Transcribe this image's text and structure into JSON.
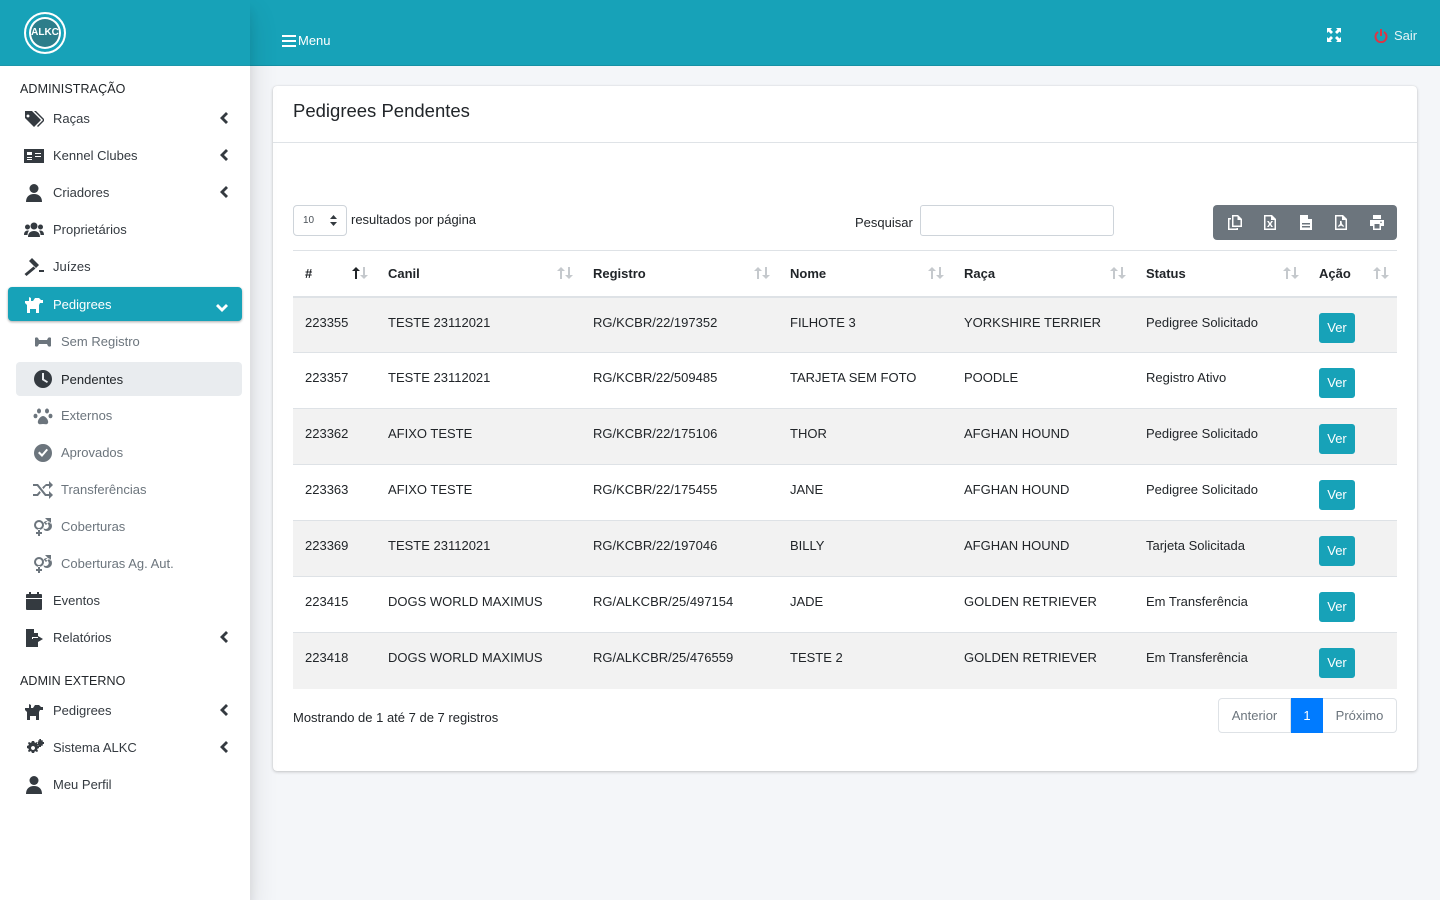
{
  "brand": {
    "logo_text": "ALKC"
  },
  "sidebar": {
    "header_admin": "ADMINISTRAÇÃO",
    "header_external": "ADMIN EXTERNO",
    "items": [
      {
        "label": "Raças",
        "icon": "tags-icon"
      },
      {
        "label": "Kennel Clubes",
        "icon": "id-card-icon"
      },
      {
        "label": "Criadores",
        "icon": "user-icon"
      },
      {
        "label": "Proprietários",
        "icon": "users-icon"
      },
      {
        "label": "Juízes",
        "icon": "gavel-icon"
      },
      {
        "label": "Pedigrees",
        "icon": "dog-icon"
      }
    ],
    "subitems": [
      {
        "label": "Sem Registro",
        "icon": "bone-icon"
      },
      {
        "label": "Pendentes",
        "icon": "clock-icon"
      },
      {
        "label": "Externos",
        "icon": "paw-icon"
      },
      {
        "label": "Aprovados",
        "icon": "check-circle-icon"
      },
      {
        "label": "Transferências",
        "icon": "random-icon"
      },
      {
        "label": "Coberturas",
        "icon": "venus-mars-icon"
      },
      {
        "label": "Coberturas Ag. Aut.",
        "icon": "venus-mars-icon"
      }
    ],
    "items2": [
      {
        "label": "Eventos",
        "icon": "calendar-icon"
      },
      {
        "label": "Relatórios",
        "icon": "file-export-icon"
      }
    ],
    "external_items": [
      {
        "label": "Pedigrees",
        "icon": "dog-icon"
      },
      {
        "label": "Sistema ALKC",
        "icon": "cogs-icon"
      },
      {
        "label": "Meu Perfil",
        "icon": "user-icon"
      }
    ]
  },
  "topbar": {
    "menu_label": "Menu",
    "logout_label": "Sair"
  },
  "card": {
    "title": "Pedigrees Pendentes"
  },
  "controls": {
    "page_length": "10",
    "page_length_label": "resultados por página",
    "search_label": "Pesquisar",
    "search_value": ""
  },
  "table": {
    "columns": [
      "#",
      "Canil",
      "Registro",
      "Nome",
      "Raça",
      "Status",
      "Ação"
    ],
    "rows": [
      {
        "id": "223355",
        "canil": "TESTE 23112021",
        "registro": "RG/KCBR/22/197352",
        "nome": "FILHOTE 3",
        "raca": "YORKSHIRE TERRIER",
        "status": "Pedigree Solicitado",
        "acao": "Ver"
      },
      {
        "id": "223357",
        "canil": "TESTE 23112021",
        "registro": "RG/KCBR/22/509485",
        "nome": "TARJETA SEM FOTO",
        "raca": "POODLE",
        "status": "Registro Ativo",
        "acao": "Ver"
      },
      {
        "id": "223362",
        "canil": "AFIXO TESTE",
        "registro": "RG/KCBR/22/175106",
        "nome": "THOR",
        "raca": "AFGHAN HOUND",
        "status": "Pedigree Solicitado",
        "acao": "Ver"
      },
      {
        "id": "223363",
        "canil": "AFIXO TESTE",
        "registro": "RG/KCBR/22/175455",
        "nome": "JANE",
        "raca": "AFGHAN HOUND",
        "status": "Pedigree Solicitado",
        "acao": "Ver"
      },
      {
        "id": "223369",
        "canil": "TESTE 23112021",
        "registro": "RG/KCBR/22/197046",
        "nome": "BILLY",
        "raca": "AFGHAN HOUND",
        "status": "Tarjeta Solicitada",
        "acao": "Ver"
      },
      {
        "id": "223415",
        "canil": "DOGS WORLD MAXIMUS",
        "registro": "RG/ALKCBR/25/497154",
        "nome": "JADE",
        "raca": "GOLDEN RETRIEVER",
        "status": "Em Transferência",
        "acao": "Ver"
      },
      {
        "id": "223418",
        "canil": "DOGS WORLD MAXIMUS",
        "registro": "RG/ALKCBR/25/476559",
        "nome": "TESTE 2",
        "raca": "GOLDEN RETRIEVER",
        "status": "Em Transferência",
        "acao": "Ver"
      }
    ]
  },
  "footer": {
    "info": "Mostrando de 1 até 7 de 7 registros",
    "prev": "Anterior",
    "current_page": "1",
    "next": "Próximo"
  },
  "colors": {
    "primary": "#17a2b8",
    "page_active": "#007bff",
    "button_group": "#6c757d",
    "logout_icon": "#dc3545"
  }
}
